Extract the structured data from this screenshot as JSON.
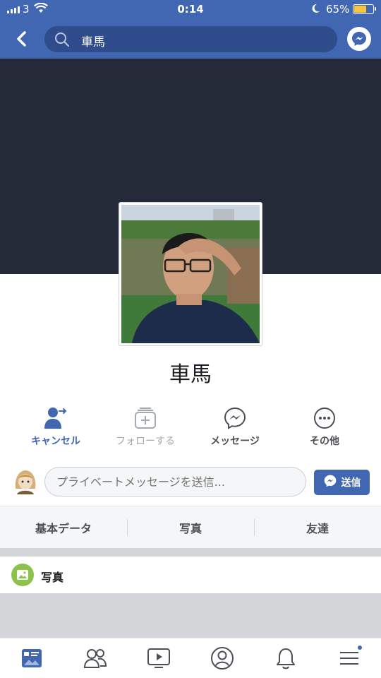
{
  "status_bar": {
    "carrier": "3",
    "time": "0:14",
    "battery": "65%",
    "battery_level": 0.65
  },
  "header": {
    "search_query": "車馬"
  },
  "profile": {
    "name": "車馬"
  },
  "actions": [
    {
      "label": "キャンセル",
      "icon": "person-cancel-icon"
    },
    {
      "label": "フォローする",
      "icon": "follow-icon"
    },
    {
      "label": "メッセージ",
      "icon": "messenger-icon"
    },
    {
      "label": "その他",
      "icon": "more-icon"
    }
  ],
  "message_bar": {
    "placeholder": "プライベートメッセージを送信...",
    "send_label": "送信"
  },
  "tabs": [
    {
      "label": "基本データ"
    },
    {
      "label": "写真"
    },
    {
      "label": "友達"
    }
  ],
  "photos_section": {
    "title": "写真"
  },
  "bottom_nav": {
    "items": [
      "news-feed-icon",
      "friends-icon",
      "watch-icon",
      "profile-icon",
      "notifications-icon",
      "menu-icon"
    ],
    "accent": "#4267b2"
  },
  "colors": {
    "brand": "#4267b2",
    "cover": "#242a38"
  }
}
